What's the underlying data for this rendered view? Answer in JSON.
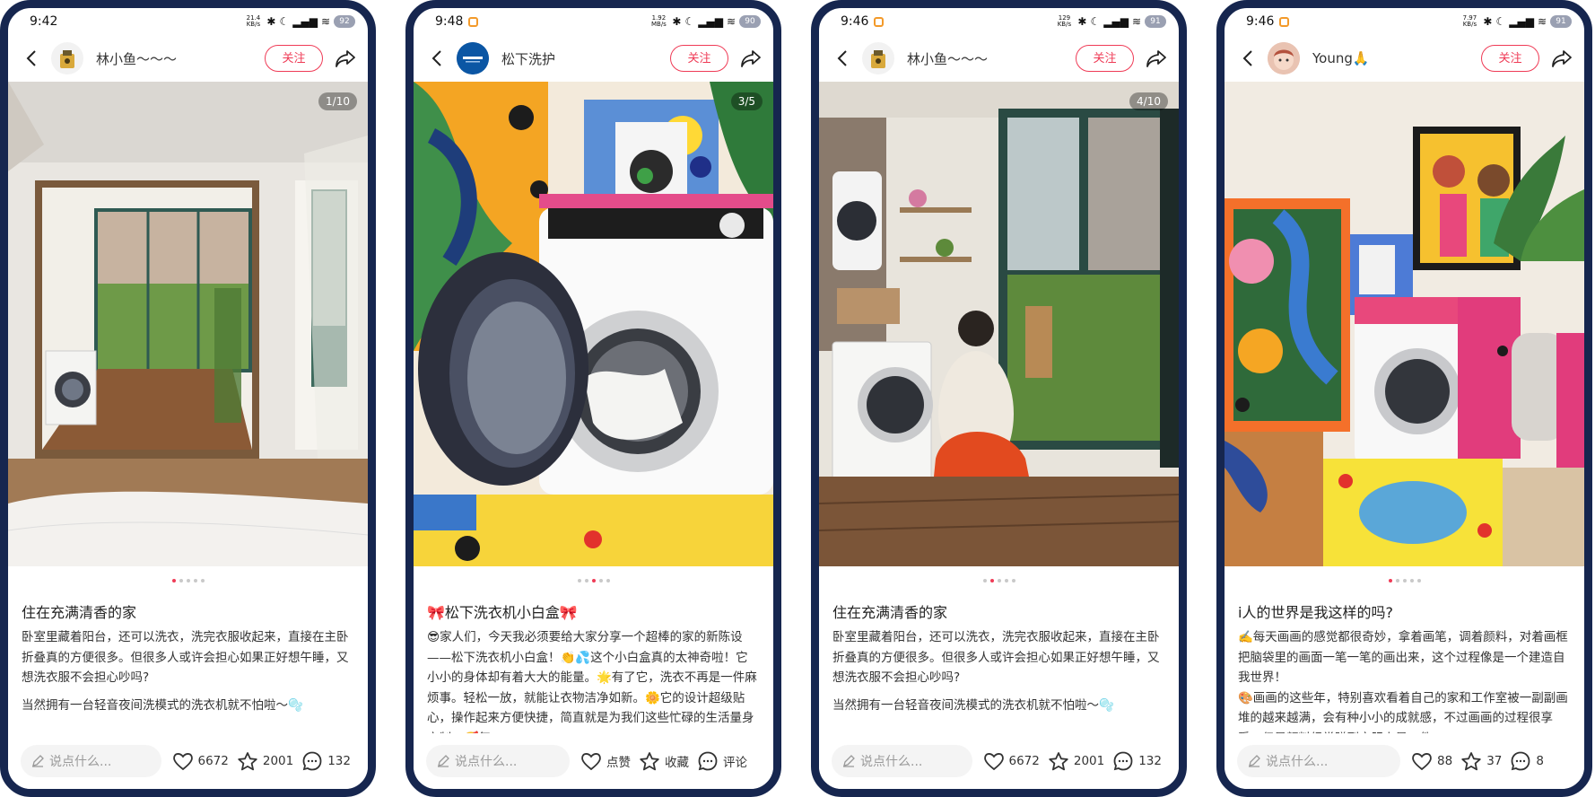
{
  "phones": [
    {
      "status": {
        "time": "9:42",
        "speed_top": "21.4",
        "speed_bottom": "KB/s",
        "battery": "92"
      },
      "author": "林小鱼～～～",
      "follow_label": "关注",
      "page_counter": "1/10",
      "title": "住在充满清香的家",
      "body": [
        "卧室里藏着阳台，还可以洗衣，洗完衣服收起来，直接在主卧折叠真的方便很多。但很多人或许会担心如果正好想午睡，又想洗衣服不会担心吵吗?",
        "当然拥有一台轻音夜间洗模式的洗衣机就不怕啦～🫧"
      ],
      "comment_placeholder": "说点什么...",
      "likes": "6672",
      "favorites": "2001",
      "comments": "132"
    },
    {
      "status": {
        "time": "9:48",
        "speed_top": "1.92",
        "speed_bottom": "MB/s",
        "battery": "90"
      },
      "author": "松下洗护",
      "follow_label": "关注",
      "page_counter": "3/5",
      "title": "🎀松下洗衣机小白盒🎀",
      "body": [
        "😎家人们，今天我必须要给大家分享一个超棒的家的新陈设——松下洗衣机小白盒！👏💦这个小白盒真的太神奇啦！它小小的身体却有着大大的能量。🌟有了它，洗衣不再是一件麻烦事。轻松一放，就能让衣物洁净如新。🌼它的设计超级贴心，操作起来方便快捷，简直就是为我们这些忙碌的生活量身定制。🥰每"
      ],
      "comment_placeholder": "说点什么...",
      "likes": "点赞",
      "favorites": "收藏",
      "comments": "评论"
    },
    {
      "status": {
        "time": "9:46",
        "speed_top": "129",
        "speed_bottom": "KB/s",
        "battery": "91"
      },
      "author": "林小鱼～～～",
      "follow_label": "关注",
      "page_counter": "4/10",
      "title": "住在充满清香的家",
      "body": [
        "卧室里藏着阳台，还可以洗衣，洗完衣服收起来，直接在主卧折叠真的方便很多。但很多人或许会担心如果正好想午睡，又想洗衣服不会担心吵吗?",
        "当然拥有一台轻音夜间洗模式的洗衣机就不怕啦～🫧"
      ],
      "comment_placeholder": "说点什么...",
      "likes": "6672",
      "favorites": "2001",
      "comments": "132"
    },
    {
      "status": {
        "time": "9:46",
        "speed_top": "7.97",
        "speed_bottom": "KB/s",
        "battery": "91"
      },
      "author": "Young🙏",
      "follow_label": "关注",
      "page_counter": "",
      "title": "i人的世界是我这样的吗?",
      "body": [
        "✍️每天画画的感觉都很奇妙，拿着画笔，调着颜料，对着画框把脑袋里的画面一笔一笔的画出来，这个过程像是一个建造自我世界！",
        "🎨画画的这些年，特别喜欢看着自己的家和工作室被一副副画堆的越来越满，会有种小小的成就感，不过画画的过程很享受，但是颜料经常蹭到衣服上是一件"
      ],
      "comment_placeholder": "说点什么...",
      "likes": "88",
      "favorites": "37",
      "comments": "8"
    }
  ]
}
